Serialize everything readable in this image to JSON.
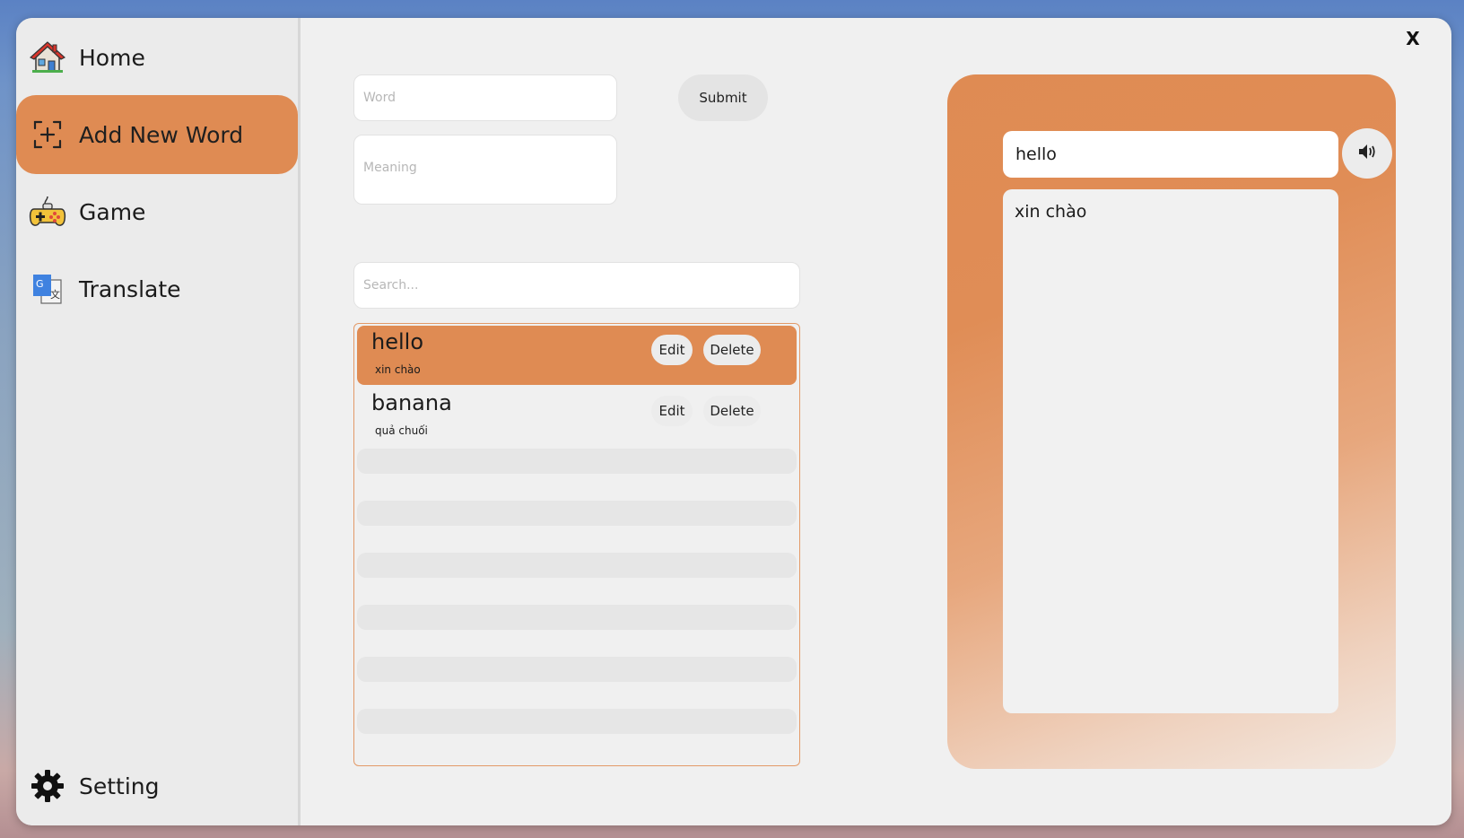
{
  "window": {
    "close_label": "X"
  },
  "sidebar": {
    "items": [
      {
        "label": "Home",
        "icon": "house-icon",
        "active": false
      },
      {
        "label": "Add New Word",
        "icon": "add-icon",
        "active": true
      },
      {
        "label": "Game",
        "icon": "gamepad-icon",
        "active": false
      },
      {
        "label": "Translate",
        "icon": "translate-icon",
        "active": false
      }
    ],
    "bottom_item": {
      "label": "Setting",
      "icon": "gear-icon"
    }
  },
  "form": {
    "word_placeholder": "Word",
    "word_value": "",
    "meaning_placeholder": "Meaning",
    "meaning_value": "",
    "submit_label": "Submit"
  },
  "search": {
    "placeholder": "Search...",
    "value": ""
  },
  "word_list": {
    "rows": [
      {
        "word": "hello",
        "meaning": "xin chào",
        "selected": true,
        "edit_label": "Edit",
        "delete_label": "Delete"
      },
      {
        "word": "banana",
        "meaning": "quả chuối",
        "selected": false,
        "edit_label": "Edit",
        "delete_label": "Delete"
      }
    ]
  },
  "detail": {
    "word": "hello",
    "meaning": "xin chào",
    "speaker_icon": "speaker-icon"
  },
  "colors": {
    "accent": "#df8b53",
    "list_border": "#e39a68",
    "window_bg": "#f0f0f0",
    "sidebar_bg": "#ebebeb"
  }
}
